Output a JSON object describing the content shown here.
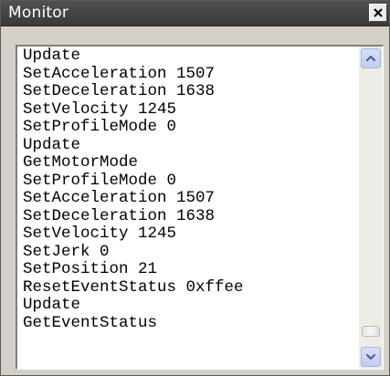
{
  "window": {
    "title": "Monitor"
  },
  "log": {
    "lines": [
      "Update",
      "SetAcceleration 1507",
      "SetDeceleration 1638",
      "SetVelocity 1245",
      "SetProfileMode 0",
      "Update",
      "GetMotorMode",
      "SetProfileMode 0",
      "SetAcceleration 1507",
      "SetDeceleration 1638",
      "SetVelocity 1245",
      "SetJerk 0",
      "SetPosition 21",
      "ResetEventStatus 0xffee",
      "Update",
      "GetEventStatus"
    ]
  },
  "scrollbar": {
    "position_fraction": 0.97
  },
  "icons": {
    "close": "close-icon",
    "scroll_up": "chevron-up-icon",
    "scroll_down": "chevron-down-icon"
  },
  "colors": {
    "titlebar": "#444444",
    "title_text": "#ffffff",
    "scroll_button": "#c8d3f3",
    "arrow": "#4d6185"
  }
}
